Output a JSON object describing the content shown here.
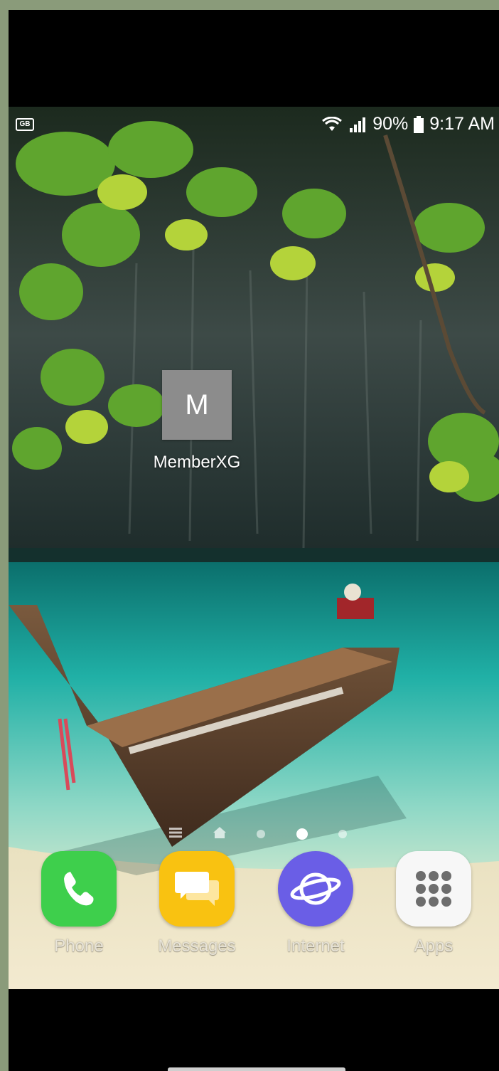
{
  "status_bar": {
    "battery": "90%",
    "time": "9:17 AM",
    "notification_badge": "GB",
    "icons": [
      "wifi-icon",
      "signal-icon",
      "battery-icon"
    ]
  },
  "home_screen": {
    "app_shortcut": {
      "letter": "M",
      "label": "MemberXG"
    },
    "page_indicator": {
      "pages": 5,
      "active_index": 3
    }
  },
  "dock": [
    {
      "label": "Phone",
      "icon": "phone-icon",
      "color": "#3ecf4c"
    },
    {
      "label": "Messages",
      "icon": "messages-icon",
      "color": "#f9c211"
    },
    {
      "label": "Internet",
      "icon": "internet-icon",
      "color": "#6a5ee6"
    },
    {
      "label": "Apps",
      "icon": "apps-grid-icon",
      "color": "#f7f7f7"
    }
  ]
}
